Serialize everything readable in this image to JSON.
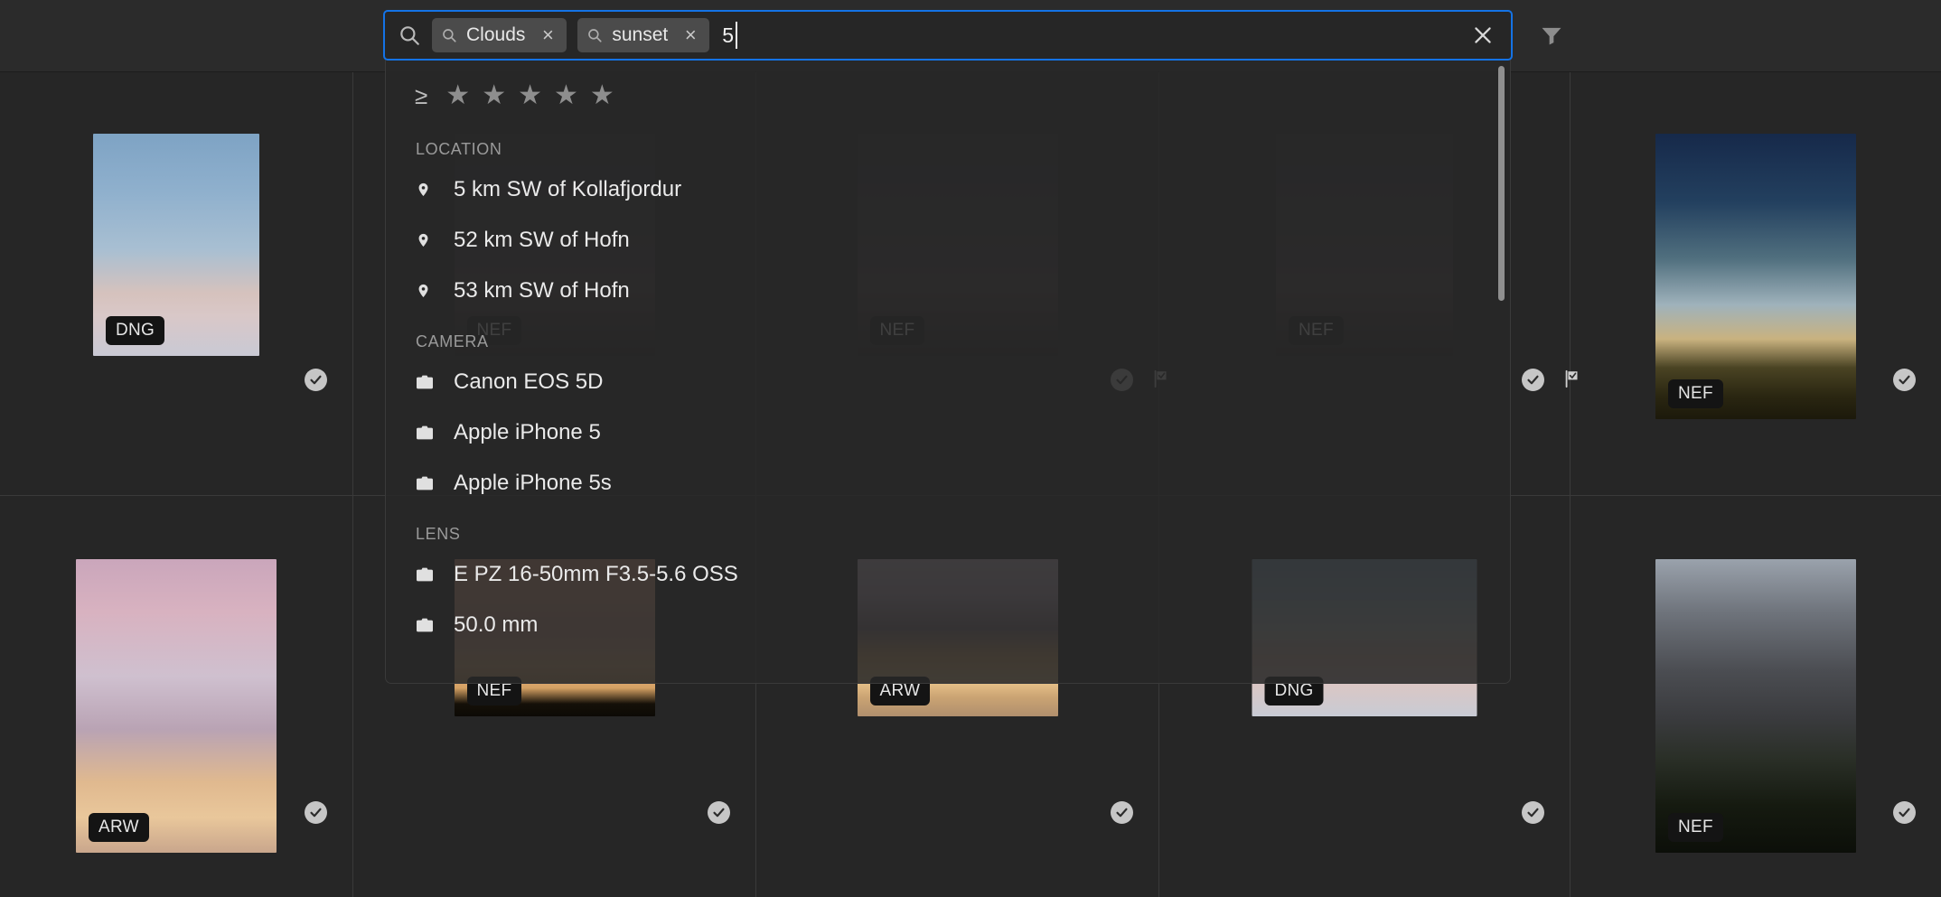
{
  "search": {
    "magnifier_icon": "search-icon",
    "tokens": [
      {
        "label": "Clouds",
        "icon": "search-icon",
        "remove_label": "×"
      },
      {
        "label": "sunset",
        "icon": "search-icon",
        "remove_label": "×"
      }
    ],
    "typed_text": "5",
    "clear_label": "×",
    "filter_icon": "filter-funnel-icon",
    "accent_color": "#1473e6"
  },
  "dropdown": {
    "rating": {
      "operator": "≥",
      "stars": [
        "★",
        "★",
        "★",
        "★",
        "★"
      ],
      "star_count": 5
    },
    "sections": [
      {
        "title": "LOCATION",
        "icon": "map-pin-icon",
        "items": [
          {
            "label": "5 km SW of Kollafjordur"
          },
          {
            "label": "52 km SW of Hofn"
          },
          {
            "label": "53 km SW of Hofn"
          }
        ]
      },
      {
        "title": "CAMERA",
        "icon": "camera-icon",
        "items": [
          {
            "label": "Canon EOS 5D"
          },
          {
            "label": "Apple iPhone 5"
          },
          {
            "label": "Apple iPhone 5s"
          }
        ]
      },
      {
        "title": "LENS",
        "icon": "camera-icon",
        "items": [
          {
            "label": "E PZ 16-50mm F3.5-5.6 OSS"
          },
          {
            "label": "50.0 mm"
          }
        ]
      }
    ]
  },
  "grid": {
    "columns": 5,
    "rows": [
      {
        "cells": [
          {
            "badge": "DNG",
            "selected": true,
            "flagged": false,
            "thumb_w": 184,
            "thumb_h": 246,
            "sky": "cirrus-blue"
          },
          {
            "badge": "NEF",
            "selected": false,
            "flagged": false,
            "thumb_w": 222,
            "thumb_h": 246,
            "sky": "dark-dusk"
          },
          {
            "badge": "NEF",
            "selected": true,
            "flagged": true,
            "thumb_w": 222,
            "thumb_h": 246,
            "sky": "dark-dusk"
          },
          {
            "badge": "NEF",
            "selected": true,
            "flagged": true,
            "thumb_w": 196,
            "thumb_h": 246,
            "sky": "dark-dusk"
          },
          {
            "badge": "NEF",
            "selected": true,
            "flagged": false,
            "thumb_w": 222,
            "thumb_h": 316,
            "sky": "sunset-field"
          }
        ]
      },
      {
        "cells": [
          {
            "badge": "ARW",
            "selected": true,
            "flagged": false,
            "thumb_w": 222,
            "thumb_h": 325,
            "sky": "pink-sea"
          },
          {
            "badge": "NEF",
            "selected": true,
            "flagged": false,
            "thumb_w": 222,
            "thumb_h": 174,
            "sky": "orange-grass"
          },
          {
            "badge": "ARW",
            "selected": true,
            "flagged": false,
            "thumb_w": 222,
            "thumb_h": 174,
            "sky": "golden-isles"
          },
          {
            "badge": "DNG",
            "selected": true,
            "flagged": false,
            "thumb_w": 249,
            "thumb_h": 174,
            "sky": "cloudtop"
          },
          {
            "badge": "NEF",
            "selected": true,
            "flagged": false,
            "thumb_w": 222,
            "thumb_h": 325,
            "sky": "storm-hills"
          }
        ]
      }
    ]
  }
}
